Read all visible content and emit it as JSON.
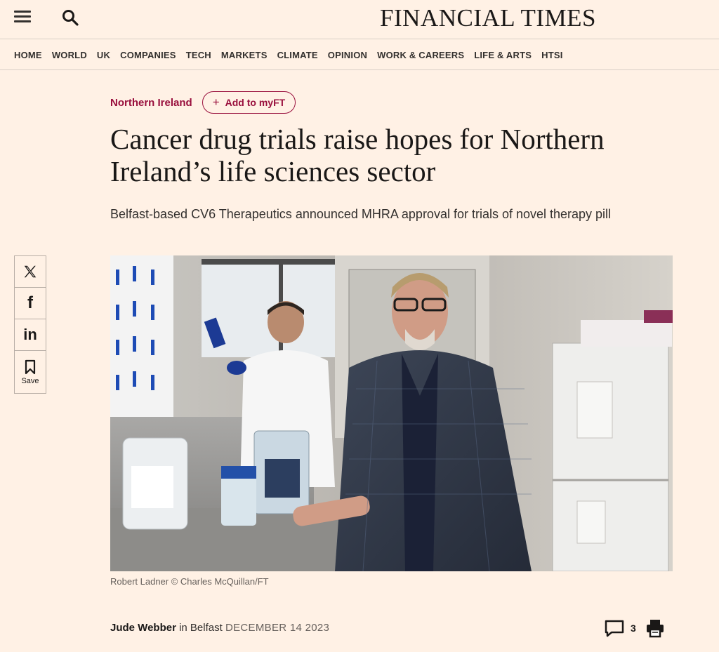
{
  "header": {
    "masthead": "FINANCIAL TIMES",
    "menu_icon": "hamburger-menu-icon",
    "search_icon": "search-icon"
  },
  "nav": {
    "items": [
      "HOME",
      "WORLD",
      "UK",
      "COMPANIES",
      "TECH",
      "MARKETS",
      "CLIMATE",
      "OPINION",
      "WORK & CAREERS",
      "LIFE & ARTS",
      "HTSI"
    ]
  },
  "article": {
    "topic": "Northern Ireland",
    "myft_button": "Add to myFT",
    "headline_line1": "Cancer drug trials raise hopes for Northern",
    "headline_line2": "Ireland’s life sciences sector",
    "standfirst": "Belfast-based CV6 Therapeutics announced MHRA approval for trials of novel therapy pill",
    "image_caption": "Robert Ladner © Charles McQuillan/FT",
    "author": "Jude Webber",
    "location_prefix": " in Belfast ",
    "date": "DECEMBER 14 2023",
    "comment_count": "3"
  },
  "share": {
    "save_label": "Save",
    "icons": [
      "x-icon",
      "facebook-icon",
      "linkedin-icon",
      "bookmark-icon"
    ]
  },
  "colors": {
    "background": "#fff1e5",
    "claret": "#990f3d",
    "text": "#33302e"
  }
}
